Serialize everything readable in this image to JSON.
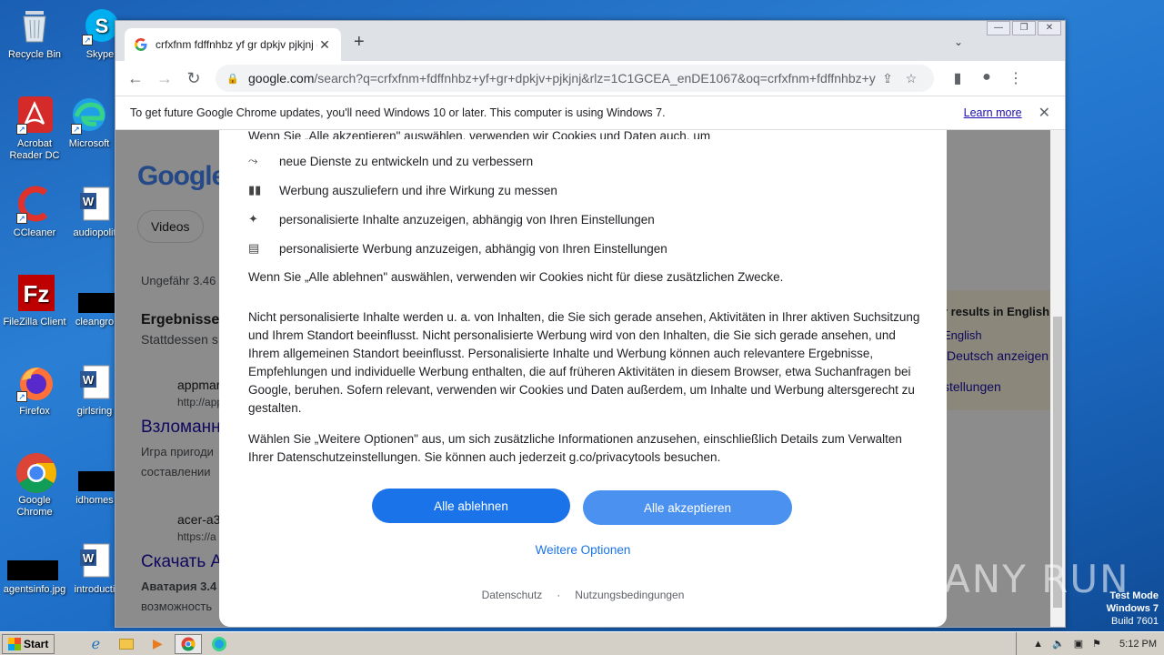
{
  "desktop": {
    "icons": [
      {
        "label": "Recycle Bin"
      },
      {
        "label": "Skype"
      },
      {
        "label": "Acrobat Reader DC"
      },
      {
        "label": "Microsoft"
      },
      {
        "label": "CCleaner"
      },
      {
        "label": "audiopolit"
      },
      {
        "label": "FileZilla Client"
      },
      {
        "label": "cleangro"
      },
      {
        "label": "Firefox"
      },
      {
        "label": "girlsring"
      },
      {
        "label": "Google Chrome"
      },
      {
        "label": "idhomes"
      },
      {
        "label": "agentsinfo.jpg"
      },
      {
        "label": "introducti"
      }
    ]
  },
  "browser": {
    "tab_title": "crfxfnm fdffnhbz yf gr dpkjv pjkjnj -",
    "url_host": "google.com",
    "url_path": "/search?q=crfxfnm+fdffnhbz+yf+gr+dpkjv+pjkjnj&rlz=1C1GCEA_enDE1067&oq=crfxfnm+fdffnhbz+y...",
    "infobar_message": "To get future Google Chrome updates, you'll need Windows 10 or later. This computer is using Windows 7.",
    "infobar_link": "Learn more"
  },
  "background_page": {
    "logo": "Google",
    "chip_videos": "Videos",
    "results_count": "Ungefähr 3.46",
    "heading": "Ergebnisse",
    "subheading": "Stattdessen s",
    "result1_site": "appmar",
    "result1_url": "http://app",
    "result1_title": "Взломанн",
    "result1_snip1": "Игра пригоди",
    "result1_snip2": "составлении",
    "result2_site": "acer-a3",
    "result2_url": "https://a",
    "result2_title": "Скачать А",
    "result2_snip1": "Аватария 3.4",
    "result2_snip2": "возможность",
    "side_head": "r results in English",
    "side_l1": "English",
    "side_l2": "Deutsch anzeigen",
    "side_l3": "stellungen"
  },
  "consent": {
    "top_line": "Wenn Sie „Alle akzeptieren\" auswählen, verwenden wir Cookies und Daten auch, um",
    "bullets": [
      {
        "icon": "trend-icon",
        "text": "neue Dienste zu entwickeln und zu verbessern"
      },
      {
        "icon": "bar-chart-icon",
        "text": "Werbung auszuliefern und ihre Wirkung zu messen"
      },
      {
        "icon": "sparkle-icon",
        "text": "personalisierte Inhalte anzuzeigen, abhängig von Ihren Einstellungen"
      },
      {
        "icon": "ad-icon",
        "text": "personalisierte Werbung anzuzeigen, abhängig von Ihren Einstellungen"
      }
    ],
    "reject_note": "Wenn Sie „Alle ablehnen\" auswählen, verwenden wir Cookies nicht für diese zusätzlichen Zwecke.",
    "paragraph1": "Nicht personalisierte Inhalte werden u. a. von Inhalten, die Sie sich gerade ansehen, Aktivitäten in Ihrer aktiven Suchsitzung und Ihrem Standort beeinflusst. Nicht personalisierte Werbung wird von den Inhalten, die Sie sich gerade ansehen, und Ihrem allgemeinen Standort beeinflusst. Personalisierte Inhalte und Werbung können auch relevantere Ergebnisse, Empfehlungen und individuelle Werbung enthalten, die auf früheren Aktivitäten in diesem Browser, etwa Suchanfragen bei Google, beruhen. Sofern relevant, verwenden wir Cookies und Daten außerdem, um Inhalte und Werbung altersgerecht zu gestalten.",
    "paragraph2": "Wählen Sie „Weitere Optionen\" aus, um sich zusätzliche Informationen anzusehen, einschließlich Details zum Verwalten Ihrer Datenschutzeinstellungen. Sie können auch jederzeit g.co/privacytools besuchen.",
    "reject_button": "Alle ablehnen",
    "accept_button": "Alle akzeptieren",
    "more_options": "Weitere Optionen",
    "footer_privacy": "Datenschutz",
    "footer_sep": "·",
    "footer_terms": "Nutzungsbedingungen"
  },
  "overlay_text": {
    "watermark": "ANY RUN",
    "test_mode": "Test Mode",
    "os": "Windows 7",
    "build": "Build 7601"
  },
  "taskbar": {
    "start_label": "Start",
    "clock": "5:12 PM"
  }
}
